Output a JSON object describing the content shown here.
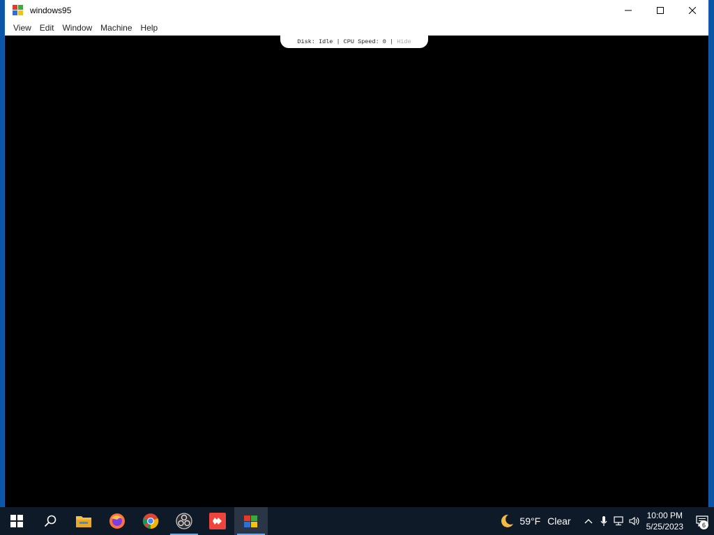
{
  "window": {
    "title": "windows95",
    "menu": [
      "View",
      "Edit",
      "Window",
      "Machine",
      "Help"
    ]
  },
  "status_bar": {
    "text": "Disk: Idle | CPU Speed: 0 | ",
    "hide_label": "Hide"
  },
  "taskbar": {
    "apps": [
      "start-icon",
      "search-icon",
      "file-explorer-icon",
      "firefox-icon",
      "chrome-icon",
      "obs-icon",
      "anydesk-icon",
      "windows95-icon"
    ],
    "active_app": "windows95-icon"
  },
  "tray": {
    "temperature": "59°F",
    "condition": "Clear",
    "time": "10:00 PM",
    "date": "5/25/2023",
    "notification_count": "6"
  },
  "colors": {
    "desktop": "#0a57a8",
    "taskbar": "#0f1a28",
    "titlebar": "#ffffff",
    "screen": "#000000"
  }
}
